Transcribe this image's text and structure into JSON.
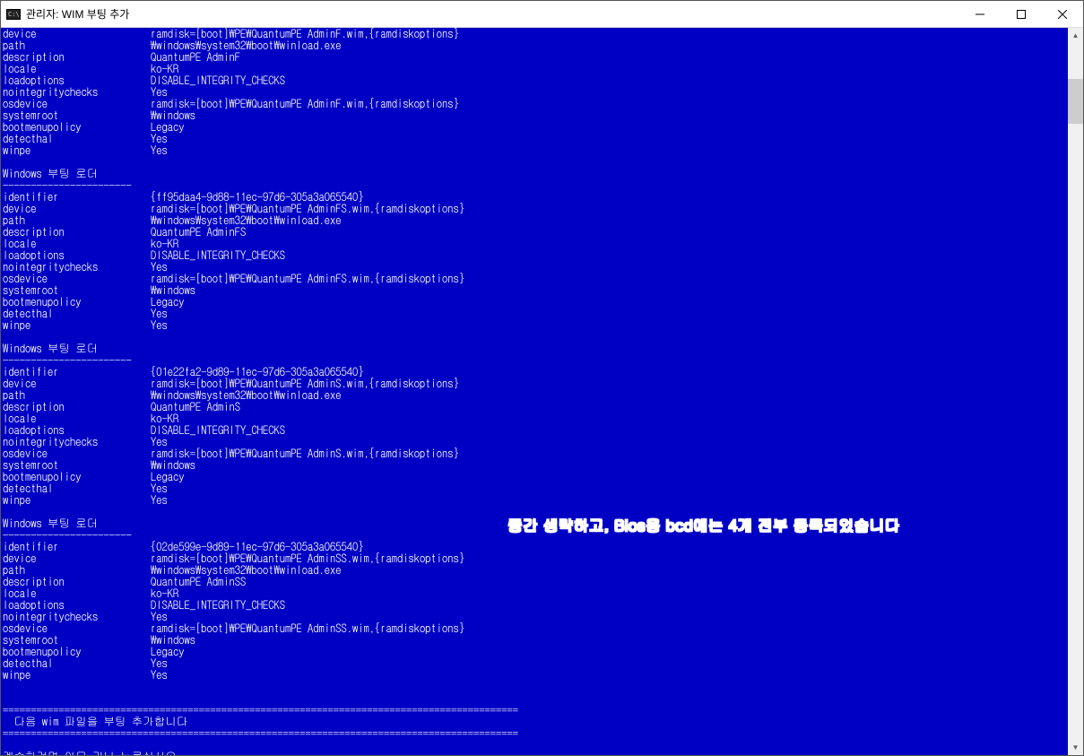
{
  "window": {
    "title": "관리자:  WIM 부팅 추가"
  },
  "annotation": "중간 생략하고, Bios용 bcd에는 4개 전부 등록되었습니다",
  "section_header": "Windows 부팅 로더",
  "section_sep": "-----------------------",
  "footer": {
    "sep": "============================================================================================",
    "line": "  다음 wim 파일을 부팅 추가합니다",
    "prompt": "계속하려면 아무 키나 누르십시오 . . ."
  },
  "loaders": [
    {
      "rows": [
        {
          "k": "device",
          "v": "ramdisk=[boot]\\PE\\QuantumPE AdminF.wim,{ramdiskoptions}"
        },
        {
          "k": "path",
          "v": "\\windows\\system32\\boot\\winload.exe"
        },
        {
          "k": "description",
          "v": "QuantumPE AdminF"
        },
        {
          "k": "locale",
          "v": "ko-KR"
        },
        {
          "k": "loadoptions",
          "v": "DISABLE_INTEGRITY_CHECKS"
        },
        {
          "k": "nointegritychecks",
          "v": "Yes"
        },
        {
          "k": "osdevice",
          "v": "ramdisk=[boot]\\PE\\QuantumPE AdminF.wim,{ramdiskoptions}"
        },
        {
          "k": "systemroot",
          "v": "\\windows"
        },
        {
          "k": "bootmenupolicy",
          "v": "Legacy"
        },
        {
          "k": "detecthal",
          "v": "Yes"
        },
        {
          "k": "winpe",
          "v": "Yes"
        }
      ]
    },
    {
      "rows": [
        {
          "k": "identifier",
          "v": "{ff95daa4-9d88-11ec-97d6-305a3a065540}"
        },
        {
          "k": "device",
          "v": "ramdisk=[boot]\\PE\\QuantumPE AdminFS.wim,{ramdiskoptions}"
        },
        {
          "k": "path",
          "v": "\\windows\\system32\\boot\\winload.exe"
        },
        {
          "k": "description",
          "v": "QuantumPE AdminFS"
        },
        {
          "k": "locale",
          "v": "ko-KR"
        },
        {
          "k": "loadoptions",
          "v": "DISABLE_INTEGRITY_CHECKS"
        },
        {
          "k": "nointegritychecks",
          "v": "Yes"
        },
        {
          "k": "osdevice",
          "v": "ramdisk=[boot]\\PE\\QuantumPE AdminFS.wim,{ramdiskoptions}"
        },
        {
          "k": "systemroot",
          "v": "\\windows"
        },
        {
          "k": "bootmenupolicy",
          "v": "Legacy"
        },
        {
          "k": "detecthal",
          "v": "Yes"
        },
        {
          "k": "winpe",
          "v": "Yes"
        }
      ]
    },
    {
      "rows": [
        {
          "k": "identifier",
          "v": "{01e22fa2-9d89-11ec-97d6-305a3a065540}"
        },
        {
          "k": "device",
          "v": "ramdisk=[boot]\\PE\\QuantumPE AdminS.wim,{ramdiskoptions}"
        },
        {
          "k": "path",
          "v": "\\windows\\system32\\boot\\winload.exe"
        },
        {
          "k": "description",
          "v": "QuantumPE AdminS"
        },
        {
          "k": "locale",
          "v": "ko-KR"
        },
        {
          "k": "loadoptions",
          "v": "DISABLE_INTEGRITY_CHECKS"
        },
        {
          "k": "nointegritychecks",
          "v": "Yes"
        },
        {
          "k": "osdevice",
          "v": "ramdisk=[boot]\\PE\\QuantumPE AdminS.wim,{ramdiskoptions}"
        },
        {
          "k": "systemroot",
          "v": "\\windows"
        },
        {
          "k": "bootmenupolicy",
          "v": "Legacy"
        },
        {
          "k": "detecthal",
          "v": "Yes"
        },
        {
          "k": "winpe",
          "v": "Yes"
        }
      ]
    },
    {
      "rows": [
        {
          "k": "identifier",
          "v": "{02de599e-9d89-11ec-97d6-305a3a065540}"
        },
        {
          "k": "device",
          "v": "ramdisk=[boot]\\PE\\QuantumPE AdminSS.wim,{ramdiskoptions}"
        },
        {
          "k": "path",
          "v": "\\windows\\system32\\boot\\winload.exe"
        },
        {
          "k": "description",
          "v": "QuantumPE AdminSS"
        },
        {
          "k": "locale",
          "v": "ko-KR"
        },
        {
          "k": "loadoptions",
          "v": "DISABLE_INTEGRITY_CHECKS"
        },
        {
          "k": "nointegritychecks",
          "v": "Yes"
        },
        {
          "k": "osdevice",
          "v": "ramdisk=[boot]\\PE\\QuantumPE AdminSS.wim,{ramdiskoptions}"
        },
        {
          "k": "systemroot",
          "v": "\\windows"
        },
        {
          "k": "bootmenupolicy",
          "v": "Legacy"
        },
        {
          "k": "detecthal",
          "v": "Yes"
        },
        {
          "k": "winpe",
          "v": "Yes"
        }
      ]
    }
  ]
}
